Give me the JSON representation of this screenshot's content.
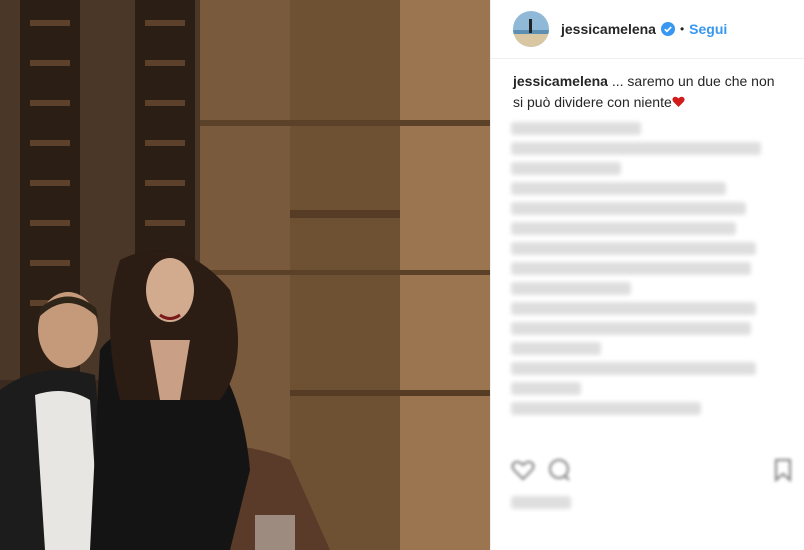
{
  "post": {
    "username": "jessicamelena",
    "follow_label": "Segui",
    "separator": "•",
    "caption_username": "jessicamelena",
    "caption_text": " ... saremo un due che non si può dividere con niente"
  },
  "colors": {
    "accent": "#3897f0",
    "verified": "#3897f0",
    "heart": "#d21b1b"
  },
  "icons": [
    "verified-badge-icon",
    "heart-icon",
    "like-icon",
    "comment-icon",
    "save-icon"
  ]
}
